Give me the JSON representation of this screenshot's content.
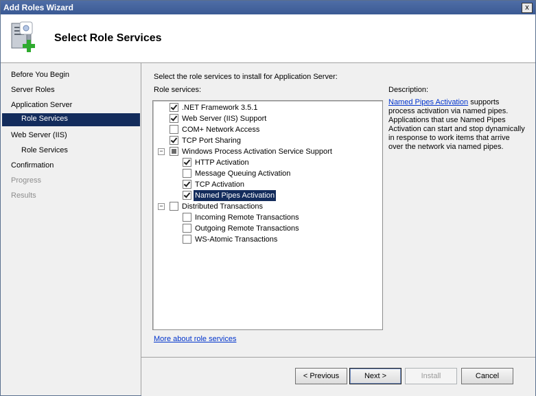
{
  "window": {
    "title": "Add Roles Wizard",
    "close_label": "x"
  },
  "header": {
    "title": "Select Role Services",
    "icon": "server-add-icon"
  },
  "nav": {
    "items": [
      {
        "label": "Before You Begin",
        "state": "normal"
      },
      {
        "label": "Server Roles",
        "state": "normal"
      },
      {
        "label": "Application Server",
        "state": "normal"
      },
      {
        "label": "Role Services",
        "state": "selected"
      },
      {
        "label": "Web Server (IIS)",
        "state": "normal"
      },
      {
        "label": "Role Services",
        "state": "normal"
      },
      {
        "label": "Confirmation",
        "state": "normal"
      },
      {
        "label": "Progress",
        "state": "disabled"
      },
      {
        "label": "Results",
        "state": "disabled"
      }
    ]
  },
  "content": {
    "instruction": "Select the role services to install for Application Server:",
    "role_services_label": "Role services:",
    "tree": [
      {
        "label": ".NET Framework 3.5.1",
        "state": "checked",
        "level": 0
      },
      {
        "label": "Web Server (IIS) Support",
        "state": "checked",
        "level": 0
      },
      {
        "label": "COM+ Network Access",
        "state": "unchecked",
        "level": 0
      },
      {
        "label": "TCP Port Sharing",
        "state": "checked",
        "level": 0
      },
      {
        "label": "Windows Process Activation Service Support",
        "state": "partial",
        "level": 0,
        "expander": "−"
      },
      {
        "label": "HTTP Activation",
        "state": "checked",
        "level": 1
      },
      {
        "label": "Message Queuing Activation",
        "state": "unchecked",
        "level": 1
      },
      {
        "label": "TCP Activation",
        "state": "checked",
        "level": 1
      },
      {
        "label": "Named Pipes Activation",
        "state": "checked",
        "level": 1,
        "selected": true
      },
      {
        "label": "Distributed Transactions",
        "state": "unchecked",
        "level": 0,
        "expander": "−"
      },
      {
        "label": "Incoming Remote Transactions",
        "state": "unchecked",
        "level": 1
      },
      {
        "label": "Outgoing Remote Transactions",
        "state": "unchecked",
        "level": 1
      },
      {
        "label": "WS-Atomic Transactions",
        "state": "unchecked",
        "level": 1
      }
    ],
    "description_title": "Description:",
    "description_link": "Named Pipes Activation",
    "description_text": " supports process activation via named pipes. Applications that use Named Pipes Activation can start and stop dynamically in response to work items that arrive over the network via named pipes.",
    "more_link": "More about role services"
  },
  "footer": {
    "previous": "< Previous",
    "next": "Next >",
    "install": "Install",
    "cancel": "Cancel"
  }
}
